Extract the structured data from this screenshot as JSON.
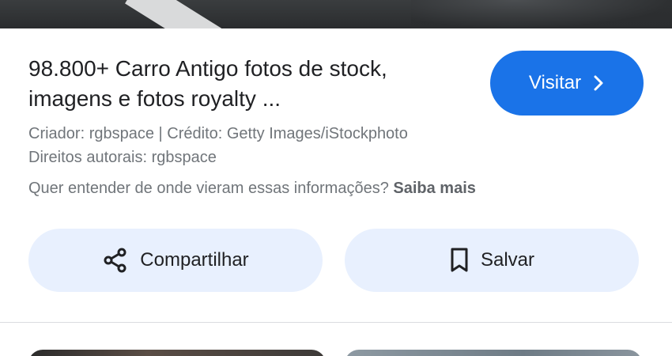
{
  "header": {
    "title": "98.800+ Carro Antigo fotos de stock, imagens e fotos royalty ..."
  },
  "visit_button": {
    "label": "Visitar",
    "icon": "chevron-right-icon"
  },
  "meta": {
    "creator_credit": "Criador: rgbspace | Crédito: Getty Images/iStockphoto",
    "copyright": "Direitos autorais: rgbspace",
    "info_question": "Quer entender de onde vieram essas informações?",
    "learn_more": "Saiba mais"
  },
  "actions": {
    "share_label": "Compartilhar",
    "share_icon": "share-icon",
    "save_label": "Salvar",
    "save_icon": "bookmark-icon"
  },
  "colors": {
    "accent": "#1a73e8",
    "action_bg": "#e8f0fe",
    "text_primary": "#202124",
    "text_secondary": "#70757a"
  }
}
